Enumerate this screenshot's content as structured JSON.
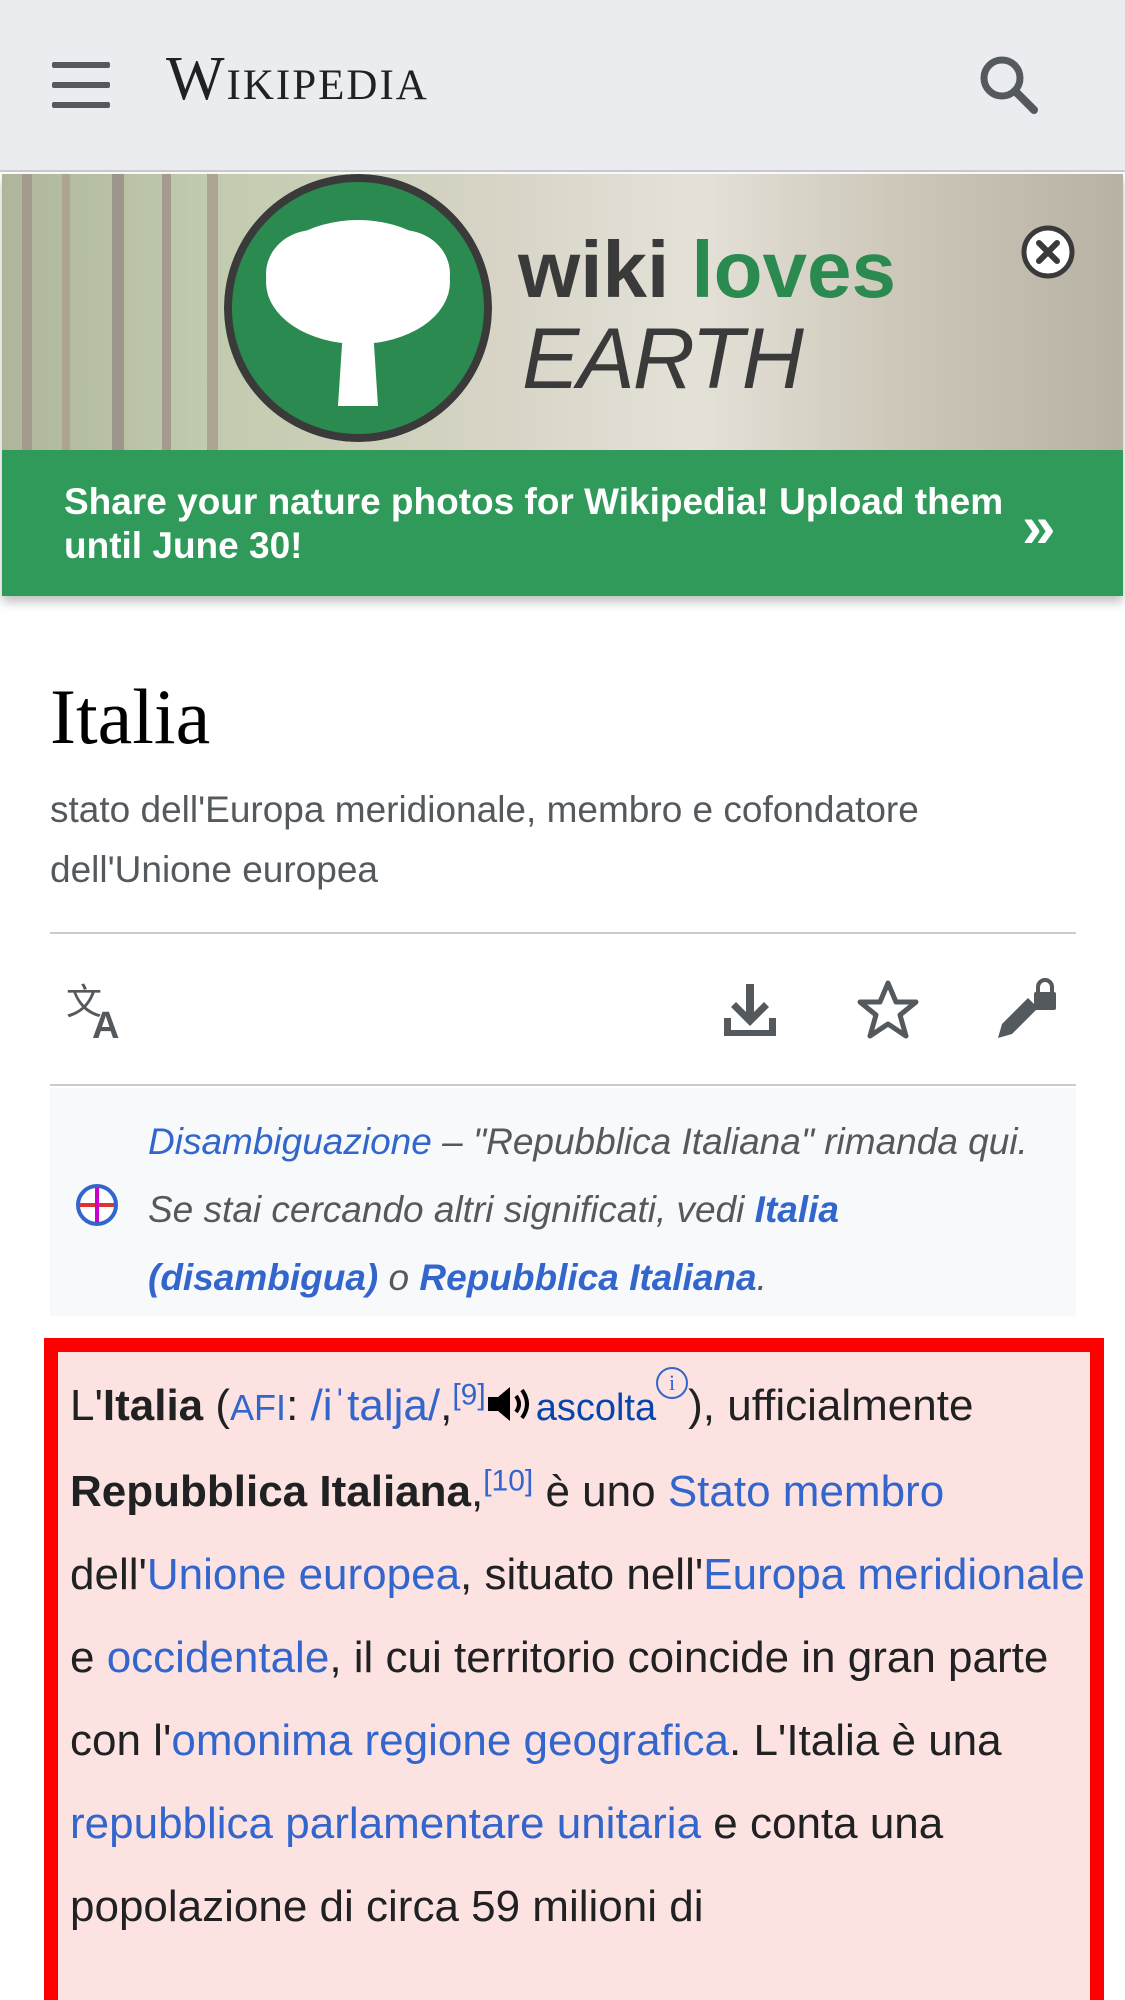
{
  "header": {
    "wordmark": "Wikipedia",
    "menu_icon": "hamburger-menu-icon",
    "search_icon": "search-icon"
  },
  "banner": {
    "logo_word_1": "wiki",
    "logo_word_2": "loves",
    "logo_word_3": "EARTH",
    "message": "Share your nature photos for Wikipedia! Upload them until June 30!",
    "cta": "»",
    "colors": {
      "green": "#2f9a5a",
      "dark": "#3a3a3a"
    }
  },
  "article": {
    "title": "Italia",
    "description": "stato dell'Europa meridionale, membro e cofondatore dell'Unione europea",
    "actions": [
      "language-icon",
      "download-icon",
      "watch-star-icon",
      "edit-locked-icon"
    ]
  },
  "hatnote": {
    "link_disambig": "Disambiguazione",
    "text_1": " – \"Repubblica Italiana\" rimanda qui. Se stai cercando altri significati, vedi ",
    "link_italia_disambigua": "Italia (disambigua)",
    "text_2": " o ",
    "link_repubblica": "Repubblica Italiana",
    "text_3": "."
  },
  "lead": {
    "t1": "L'",
    "b1": "Italia",
    "t2": " (",
    "afi": "AFI",
    "t3": ": ",
    "ipa": "/iˈtalja/",
    "t4": ",",
    "ref9": "[9]",
    "ascolta": "ascolta",
    "info": "i",
    "t5": "),",
    "t6": "ufficialmente ",
    "b2": "Repubblica Italiana",
    "t7": ",",
    "ref10": "[10]",
    "t8": " è uno ",
    "l_stato": "Stato membro",
    "t9": " dell'",
    "l_ue": "Unione europea",
    "t10": ", situato nell'",
    "l_europa": "Europa meridionale",
    "t11": " e ",
    "l_occ": "occidentale",
    "t12": ", il cui territorio coincide in gran parte con l'",
    "l_omonima": "omonima regione geografica",
    "t13": ". L'Italia è una ",
    "l_rep": "repubblica parlamentare unitaria",
    "t14": " e conta una popolazione di circa 59 milioni di"
  }
}
